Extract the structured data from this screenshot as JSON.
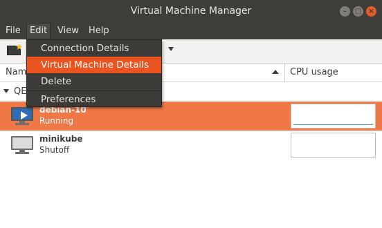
{
  "window": {
    "title": "Virtual Machine Manager",
    "controls": {
      "minimize": "–",
      "maximize": "□",
      "close": "×"
    }
  },
  "menubar": {
    "items": [
      {
        "label": "File"
      },
      {
        "label": "Edit"
      },
      {
        "label": "View"
      },
      {
        "label": "Help"
      }
    ]
  },
  "edit_menu": {
    "items": [
      {
        "label": "Connection Details",
        "highlighted": false
      },
      {
        "label": "Virtual Machine Details",
        "highlighted": true
      },
      {
        "label": "Delete",
        "highlighted": false
      },
      {
        "label": "Preferences",
        "highlighted": false
      }
    ]
  },
  "toolbar": {
    "new_vm_icon": "new-vm-icon",
    "dropdown_icon": "chevron-down-icon"
  },
  "columns": {
    "name": "Nam",
    "cpu_usage": "CPU usage"
  },
  "group": {
    "label": "QE"
  },
  "vms": [
    {
      "name": "debian-10",
      "status": "Running",
      "selected": true,
      "icon": "vm-running-icon"
    },
    {
      "name": "minikube",
      "status": "Shutoff",
      "selected": false,
      "icon": "vm-shutoff-icon"
    }
  ],
  "colors": {
    "titlebar": "#3e3d39",
    "selection": "#f07746",
    "menu_highlight": "#e95420",
    "menu_bg": "#3c3b37"
  }
}
